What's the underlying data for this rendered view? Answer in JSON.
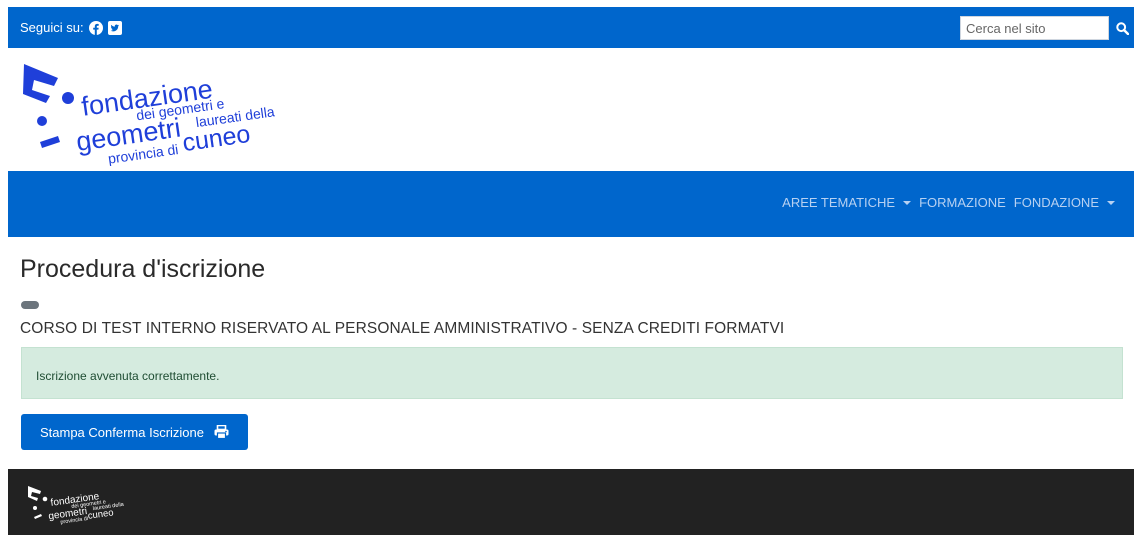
{
  "topbar": {
    "follow_label": "Seguici su:",
    "social_icons": [
      "facebook-icon",
      "twitter-icon"
    ],
    "search_placeholder": "Cerca nel sito"
  },
  "brand": {
    "line1": "fondazione",
    "line2": "dei geometri e",
    "line3": "geometri",
    "line4": "laureati della",
    "line5": "provincia di",
    "line6": "cuneo"
  },
  "nav": {
    "items": [
      {
        "label": "AREE TEMATICHE",
        "dropdown": true
      },
      {
        "label": "FORMAZIONE",
        "dropdown": false
      },
      {
        "label": "FONDAZIONE",
        "dropdown": true
      }
    ]
  },
  "main": {
    "title": "Procedura d'iscrizione",
    "course": "CORSO DI TEST INTERNO RISERVATO AL PERSONALE AMMINISTRATIVO - SENZA CREDITI FORMATVI",
    "alert": "Iscrizione avvenuta correttamente.",
    "print_button": "Stampa Conferma Iscrizione"
  },
  "colors": {
    "primary": "#0066cc",
    "footer": "#222222",
    "alert_bg": "#d5ebdf"
  }
}
